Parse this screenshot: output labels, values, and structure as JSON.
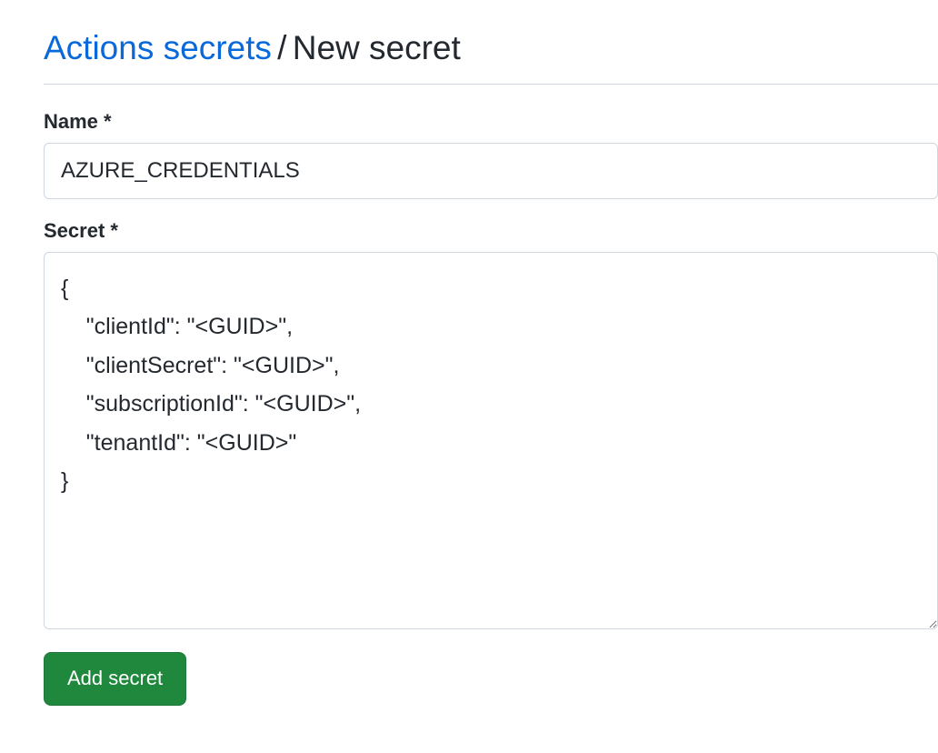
{
  "header": {
    "link_text": "Actions secrets",
    "separator": "/",
    "current": "New secret"
  },
  "form": {
    "name_label": "Name *",
    "name_value": "AZURE_CREDENTIALS",
    "secret_label": "Secret *",
    "secret_value": "{\n    \"clientId\": \"<GUID>\",\n    \"clientSecret\": \"<GUID>\",\n    \"subscriptionId\": \"<GUID>\",\n    \"tenantId\": \"<GUID>\"\n}",
    "submit_label": "Add secret"
  }
}
